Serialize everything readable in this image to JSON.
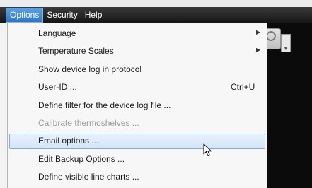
{
  "menubar": {
    "items": [
      {
        "label": "Options",
        "active": true
      },
      {
        "label": "Security",
        "active": false
      },
      {
        "label": "Help",
        "active": false
      }
    ]
  },
  "options_menu": {
    "items": [
      {
        "label": "Language",
        "shortcut": "",
        "submenu": true,
        "enabled": true,
        "highlighted": false
      },
      {
        "label": "Temperature Scales",
        "shortcut": "",
        "submenu": true,
        "enabled": true,
        "highlighted": false
      },
      {
        "label": "Show device log in protocol",
        "shortcut": "",
        "submenu": false,
        "enabled": true,
        "highlighted": false
      },
      {
        "label": "User-ID ...",
        "shortcut": "Ctrl+U",
        "submenu": false,
        "enabled": true,
        "highlighted": false
      },
      {
        "label": "Define filter for the device log file ...",
        "shortcut": "",
        "submenu": false,
        "enabled": true,
        "highlighted": false
      },
      {
        "label": "Calibrate thermoshelves ...",
        "shortcut": "",
        "submenu": false,
        "enabled": false,
        "highlighted": false
      },
      {
        "label": "Email options ...",
        "shortcut": "",
        "submenu": false,
        "enabled": true,
        "highlighted": true
      },
      {
        "label": "Edit Backup Options ...",
        "shortcut": "",
        "submenu": false,
        "enabled": true,
        "highlighted": false
      },
      {
        "label": "Define visible line charts ...",
        "shortcut": "",
        "submenu": false,
        "enabled": true,
        "highlighted": false
      }
    ],
    "submenu_arrow_icon": "triangle-right-icon"
  },
  "colors": {
    "menubar_bg": "#1e1e1e",
    "active_menu_bg": "#3f87d2",
    "highlight_bg": "#d9e8f8",
    "highlight_border": "#7faedc",
    "disabled_text": "#9b9b9b"
  },
  "cursor_icon": "mouse-pointer-icon"
}
